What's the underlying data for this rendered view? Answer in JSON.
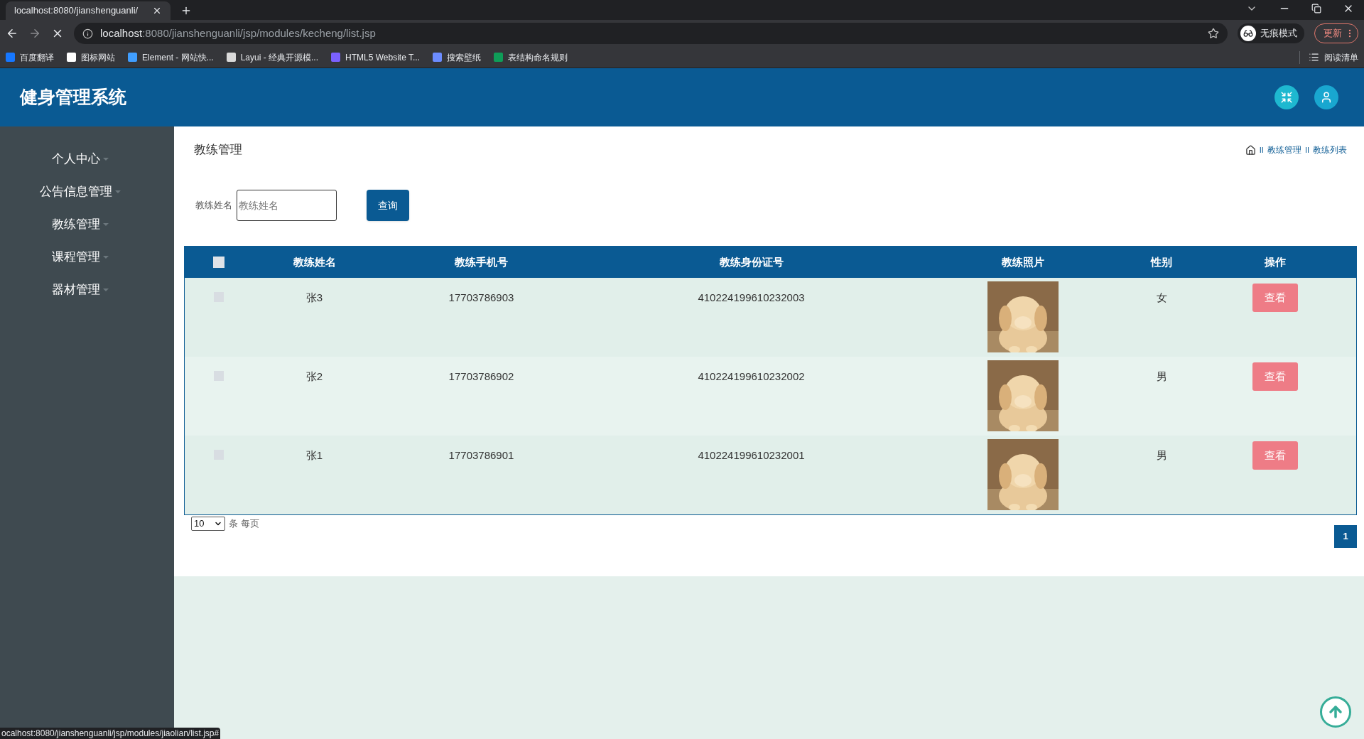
{
  "browser": {
    "tab_title": "localhost:8080/jianshenguanli/",
    "address_host": "localhost",
    "address_path": ":8080/jianshenguanli/jsp/modules/kecheng/list.jsp",
    "profile_label": "无痕模式",
    "update_label": "更新",
    "bookmarks": [
      {
        "label": "百度翻译",
        "color": "#1677ff"
      },
      {
        "label": "图标网站",
        "color": "#ffffff"
      },
      {
        "label": "Element - 网站快...",
        "color": "#409eff"
      },
      {
        "label": "Layui - 经典开源模...",
        "color": "#d9d9d9"
      },
      {
        "label": "HTML5 Website T...",
        "color": "#7b61ff"
      },
      {
        "label": "搜索壁纸",
        "color": "#6c8cff"
      },
      {
        "label": "表结构命名规则",
        "color": "#0f9d58"
      }
    ],
    "reading_list": "阅读清单",
    "status_url": "ocalhost:8080/jianshenguanli/jsp/modules/jiaolian/list.jsp#"
  },
  "app": {
    "title": "健身管理系统"
  },
  "sidebar": {
    "items": [
      {
        "label": "个人中心"
      },
      {
        "label": "公告信息管理"
      },
      {
        "label": "教练管理"
      },
      {
        "label": "课程管理"
      },
      {
        "label": "器材管理"
      }
    ]
  },
  "page": {
    "title": "教练管理",
    "breadcrumb": [
      {
        "separator": "II",
        "label": "教练管理"
      },
      {
        "separator": "II",
        "label": "教练列表"
      }
    ]
  },
  "search": {
    "label": "教练姓名",
    "placeholder": "教练姓名",
    "button": "查询"
  },
  "table": {
    "header_checked": false,
    "columns": [
      "教练姓名",
      "教练手机号",
      "教练身份证号",
      "教练照片",
      "性别",
      "操作"
    ],
    "rows": [
      {
        "checked": false,
        "name": "张3",
        "phone": "17703786903",
        "id_number": "410224199610232003",
        "gender": "女",
        "action": "查看"
      },
      {
        "checked": false,
        "name": "张2",
        "phone": "17703786902",
        "id_number": "410224199610232002",
        "gender": "男",
        "action": "查看"
      },
      {
        "checked": false,
        "name": "张1",
        "phone": "17703786901",
        "id_number": "410224199610232001",
        "gender": "男",
        "action": "查看"
      }
    ]
  },
  "pagination": {
    "page_size": "10",
    "page_size_suffix": "条 每页",
    "pages": [
      {
        "label": "1",
        "selected": true
      }
    ]
  }
}
